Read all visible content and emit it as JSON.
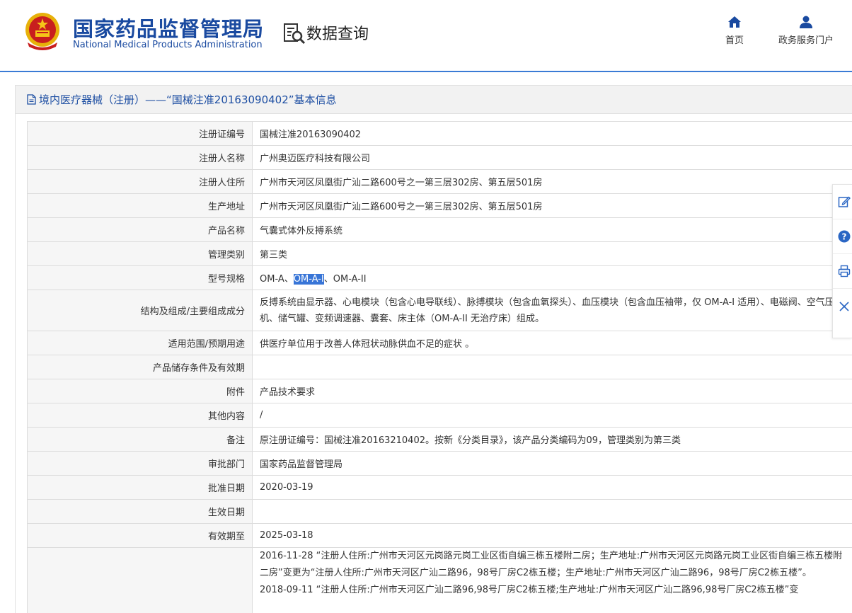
{
  "header": {
    "org_name_cn": "国家药品监督管理局",
    "org_name_en": "National Medical Products Administration",
    "section_name": "数据查询",
    "nav": {
      "home": "首页",
      "portal": "政务服务门户"
    }
  },
  "colors": {
    "brand": "#1a4aa0",
    "accent": "#3a7bd5",
    "selection": "#3875d7"
  },
  "title": "境内医疗器械（注册）——“国械注准20163090402”基本信息",
  "rows": [
    {
      "label": "注册证编号",
      "value": "国械注准20163090402"
    },
    {
      "label": "注册人名称",
      "value": "广州奥迈医疗科技有限公司"
    },
    {
      "label": "注册人住所",
      "value": "广州市天河区凤凰街广汕二路600号之一第三层302房、第五层501房"
    },
    {
      "label": "生产地址",
      "value": "广州市天河区凤凰街广汕二路600号之一第三层302房、第五层501房"
    },
    {
      "label": "产品名称",
      "value": "气囊式体外反搏系统"
    },
    {
      "label": "管理类别",
      "value": "第三类"
    },
    {
      "label": "型号规格",
      "value_parts": [
        "OM-A、",
        "OM-A-I",
        "、OM-A-II"
      ]
    },
    {
      "label": "结构及组成/主要组成成分",
      "value": "反搏系统由显示器、心电模块（包含心电导联线）、脉搏模块（包含血氧探头）、血压模块（包含血压袖带，仅 OM-A-I 适用）、电磁阀、空气压缩机、储气罐、变频调速器、囊套、床主体（OM-A-II 无治疗床）组成。"
    },
    {
      "label": "适用范围/预期用途",
      "value": "供医疗单位用于改善人体冠状动脉供血不足的症状 。"
    },
    {
      "label": "产品储存条件及有效期",
      "value": ""
    },
    {
      "label": "附件",
      "value": "产品技术要求"
    },
    {
      "label": "其他内容",
      "value": "/"
    },
    {
      "label": "备注",
      "value": "原注册证编号：国械注准20163210402。按新《分类目录》，该产品分类编码为09，管理类别为第三类"
    },
    {
      "label": "审批部门",
      "value": "国家药品监督管理局"
    },
    {
      "label": "批准日期",
      "value": "2020-03-19"
    },
    {
      "label": "生效日期",
      "value": ""
    },
    {
      "label": "有效期至",
      "value": "2025-03-18"
    },
    {
      "label": "",
      "value_lines": [
        "2016-11-28 “注册人住所:广州市天河区元岗路元岗工业区街自编三栋五楼附二房；生产地址:广州市天河区元岗路元岗工业区街自编三栋五楼附二房”变更为“注册人住所:广州市天河区广汕二路96，98号厂房C2栋五楼；生产地址:广州市天河区广汕二路96，98号厂房C2栋五楼”。",
        "2018-09-11 “注册人住所:广州市天河区广汕二路96,98号厂房C2栋五楼;生产地址:广州市天河区广汕二路96,98号厂房C2栋五楼”变"
      ]
    }
  ],
  "side_toolbar": [
    "edit-icon",
    "help-icon",
    "print-icon",
    "close-icon"
  ]
}
